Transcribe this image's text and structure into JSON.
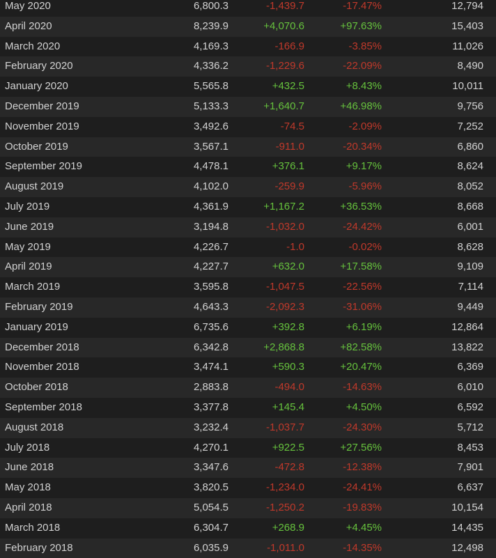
{
  "colors": {
    "positive": "#66c23d",
    "negative": "#c0392b",
    "text": "#d2d2d2"
  },
  "rows": [
    {
      "month": "May 2020",
      "avg": "6,800.3",
      "gain": "-1,439.7",
      "pct": "-17.47%",
      "peak": "12,794"
    },
    {
      "month": "April 2020",
      "avg": "8,239.9",
      "gain": "+4,070.6",
      "pct": "+97.63%",
      "peak": "15,403"
    },
    {
      "month": "March 2020",
      "avg": "4,169.3",
      "gain": "-166.9",
      "pct": "-3.85%",
      "peak": "11,026"
    },
    {
      "month": "February 2020",
      "avg": "4,336.2",
      "gain": "-1,229.6",
      "pct": "-22.09%",
      "peak": "8,490"
    },
    {
      "month": "January 2020",
      "avg": "5,565.8",
      "gain": "+432.5",
      "pct": "+8.43%",
      "peak": "10,011"
    },
    {
      "month": "December 2019",
      "avg": "5,133.3",
      "gain": "+1,640.7",
      "pct": "+46.98%",
      "peak": "9,756"
    },
    {
      "month": "November 2019",
      "avg": "3,492.6",
      "gain": "-74.5",
      "pct": "-2.09%",
      "peak": "7,252"
    },
    {
      "month": "October 2019",
      "avg": "3,567.1",
      "gain": "-911.0",
      "pct": "-20.34%",
      "peak": "6,860"
    },
    {
      "month": "September 2019",
      "avg": "4,478.1",
      "gain": "+376.1",
      "pct": "+9.17%",
      "peak": "8,624"
    },
    {
      "month": "August 2019",
      "avg": "4,102.0",
      "gain": "-259.9",
      "pct": "-5.96%",
      "peak": "8,052"
    },
    {
      "month": "July 2019",
      "avg": "4,361.9",
      "gain": "+1,167.2",
      "pct": "+36.53%",
      "peak": "8,668"
    },
    {
      "month": "June 2019",
      "avg": "3,194.8",
      "gain": "-1,032.0",
      "pct": "-24.42%",
      "peak": "6,001"
    },
    {
      "month": "May 2019",
      "avg": "4,226.7",
      "gain": "-1.0",
      "pct": "-0.02%",
      "peak": "8,628"
    },
    {
      "month": "April 2019",
      "avg": "4,227.7",
      "gain": "+632.0",
      "pct": "+17.58%",
      "peak": "9,109"
    },
    {
      "month": "March 2019",
      "avg": "3,595.8",
      "gain": "-1,047.5",
      "pct": "-22.56%",
      "peak": "7,114"
    },
    {
      "month": "February 2019",
      "avg": "4,643.3",
      "gain": "-2,092.3",
      "pct": "-31.06%",
      "peak": "9,449"
    },
    {
      "month": "January 2019",
      "avg": "6,735.6",
      "gain": "+392.8",
      "pct": "+6.19%",
      "peak": "12,864"
    },
    {
      "month": "December 2018",
      "avg": "6,342.8",
      "gain": "+2,868.8",
      "pct": "+82.58%",
      "peak": "13,822"
    },
    {
      "month": "November 2018",
      "avg": "3,474.1",
      "gain": "+590.3",
      "pct": "+20.47%",
      "peak": "6,369"
    },
    {
      "month": "October 2018",
      "avg": "2,883.8",
      "gain": "-494.0",
      "pct": "-14.63%",
      "peak": "6,010"
    },
    {
      "month": "September 2018",
      "avg": "3,377.8",
      "gain": "+145.4",
      "pct": "+4.50%",
      "peak": "6,592"
    },
    {
      "month": "August 2018",
      "avg": "3,232.4",
      "gain": "-1,037.7",
      "pct": "-24.30%",
      "peak": "5,712"
    },
    {
      "month": "July 2018",
      "avg": "4,270.1",
      "gain": "+922.5",
      "pct": "+27.56%",
      "peak": "8,453"
    },
    {
      "month": "June 2018",
      "avg": "3,347.6",
      "gain": "-472.8",
      "pct": "-12.38%",
      "peak": "7,901"
    },
    {
      "month": "May 2018",
      "avg": "3,820.5",
      "gain": "-1,234.0",
      "pct": "-24.41%",
      "peak": "6,637"
    },
    {
      "month": "April 2018",
      "avg": "5,054.5",
      "gain": "-1,250.2",
      "pct": "-19.83%",
      "peak": "10,154"
    },
    {
      "month": "March 2018",
      "avg": "6,304.7",
      "gain": "+268.9",
      "pct": "+4.45%",
      "peak": "14,435"
    },
    {
      "month": "February 2018",
      "avg": "6,035.9",
      "gain": "-1,011.0",
      "pct": "-14.35%",
      "peak": "12,498"
    }
  ]
}
